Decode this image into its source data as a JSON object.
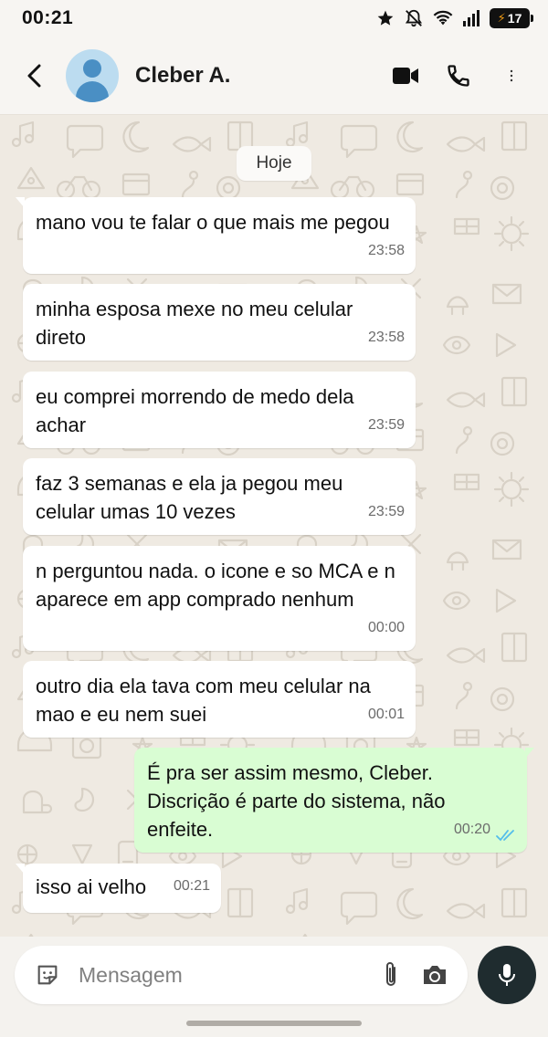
{
  "status_bar": {
    "time": "00:21",
    "battery": "17"
  },
  "header": {
    "contact_name": "Cleber A."
  },
  "chat": {
    "day_label": "Hoje",
    "messages": [
      {
        "direction": "in",
        "text": "mano vou te falar o que mais me pegou",
        "time": "23:58"
      },
      {
        "direction": "in",
        "text": "minha esposa mexe no meu celular direto",
        "time": "23:58"
      },
      {
        "direction": "in",
        "text": "eu comprei morrendo de medo dela achar",
        "time": "23:59"
      },
      {
        "direction": "in",
        "text": "faz 3 semanas e ela ja pegou meu celular umas 10 vezes",
        "time": "23:59"
      },
      {
        "direction": "in",
        "text": "n perguntou nada. o icone e so MCA e n aparece em app comprado nenhum",
        "time": "00:00"
      },
      {
        "direction": "in",
        "text": "outro dia ela tava com meu celular na mao e eu nem suei",
        "time": "00:01"
      },
      {
        "direction": "out",
        "text": "É pra ser assim mesmo, Cleber. Discrição é parte do sistema, não enfeite.",
        "time": "00:20",
        "status": "read"
      },
      {
        "direction": "in",
        "text": "isso ai velho",
        "time": "00:21"
      }
    ]
  },
  "composer": {
    "placeholder": "Mensagem"
  },
  "colors": {
    "wallpaper": "#efeae2",
    "incoming_bubble": "#ffffff",
    "outgoing_bubble": "#d9fdd3",
    "read_ticks": "#53bdeb",
    "mic_button": "#1f2c2f"
  },
  "icons": [
    "back-arrow-icon",
    "avatar-icon",
    "video-call-icon",
    "phone-icon",
    "more-options-icon",
    "sticker-icon",
    "attach-icon",
    "camera-icon",
    "mic-icon",
    "star-icon",
    "mute-icon",
    "wifi-icon",
    "signal-icon",
    "battery-icon"
  ]
}
